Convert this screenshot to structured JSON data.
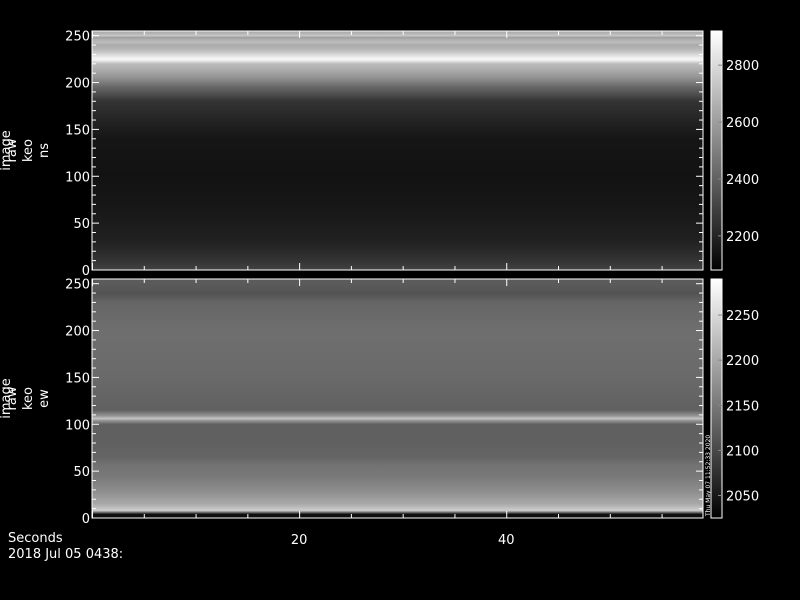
{
  "chart_data": [
    {
      "type": "heatmap",
      "colormap": "grayscale",
      "ylabel_lines": [
        "image",
        "raw",
        "keo",
        "ns"
      ],
      "y_ticks": [
        0,
        50,
        100,
        150,
        200,
        250
      ],
      "ylim": [
        0,
        255
      ],
      "colorbar_ticks": [
        2200,
        2400,
        2600,
        2800
      ],
      "colorbar_range": [
        2080,
        2920
      ],
      "row_profile": {
        "rows": [
          0,
          10,
          30,
          60,
          100,
          140,
          180,
          195,
          205,
          215,
          220,
          224,
          226,
          230,
          235,
          240,
          243,
          246,
          248,
          250,
          252,
          255
        ],
        "values": [
          2300,
          2250,
          2190,
          2160,
          2140,
          2150,
          2250,
          2420,
          2560,
          2660,
          2700,
          2880,
          2880,
          2790,
          2690,
          2640,
          2700,
          2660,
          2600,
          2740,
          2680,
          2620
        ]
      }
    },
    {
      "type": "heatmap",
      "colormap": "grayscale",
      "ylabel_lines": [
        "image",
        "raw",
        "keo",
        "ew"
      ],
      "y_ticks": [
        0,
        50,
        100,
        150,
        200,
        250
      ],
      "ylim": [
        0,
        255
      ],
      "colorbar_ticks": [
        2050,
        2100,
        2150,
        2200,
        2250
      ],
      "colorbar_range": [
        2025,
        2290
      ],
      "colorbar_caption": "Thu May 07 11:52:33 2020",
      "row_profile": {
        "rows": [
          0,
          4,
          8,
          15,
          30,
          45,
          55,
          65,
          80,
          100,
          104,
          106,
          109,
          115,
          150,
          200,
          230,
          240,
          250,
          255
        ],
        "values": [
          2040,
          2040,
          2240,
          2200,
          2170,
          2150,
          2145,
          2130,
          2125,
          2125,
          2180,
          2230,
          2180,
          2125,
          2135,
          2140,
          2130,
          2110,
          2120,
          2120
        ]
      }
    }
  ],
  "x_ticks": [
    20,
    40
  ],
  "xlim": [
    0,
    59
  ],
  "xlabel": "Seconds",
  "timestamp": "2018 Jul 05 0438:"
}
